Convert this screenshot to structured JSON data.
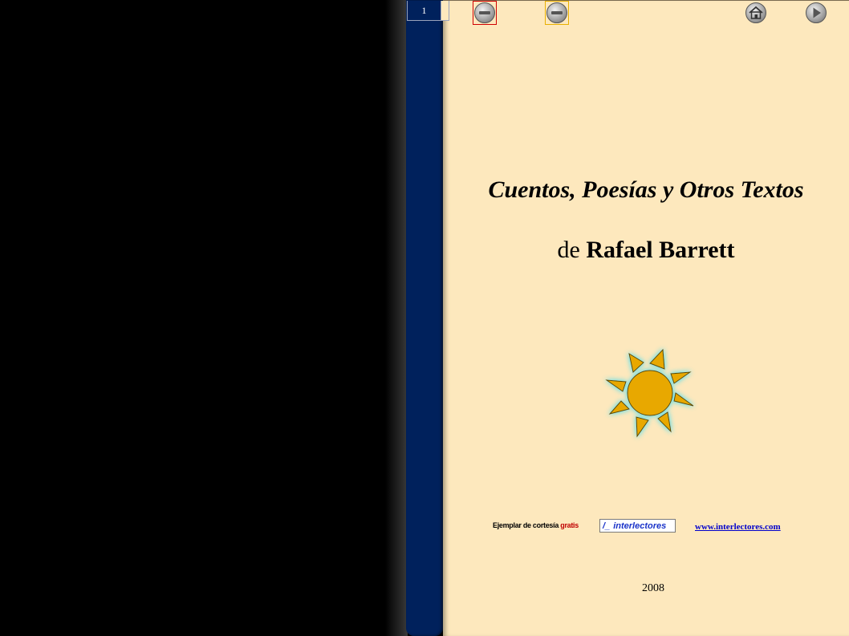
{
  "toolbar": {
    "page_number": "1",
    "buttons": [
      {
        "name": "prev-page",
        "icon": "minus-circle-icon"
      },
      {
        "name": "next-page",
        "icon": "minus-circle-icon"
      },
      {
        "name": "home",
        "icon": "home-icon"
      },
      {
        "name": "forward",
        "icon": "play-right-icon"
      }
    ]
  },
  "cover": {
    "title": "Cuentos, Poesías y Otros Textos",
    "subtitle_prefix": "de ",
    "author": "Rafael Barrett",
    "courtesy_text": "Ejemplar de cortesía ",
    "courtesy_highlight": "gratis",
    "logo_text": "interlectores",
    "url": "www.interlectores.com",
    "year": "2008"
  },
  "colors": {
    "page_background": "#fde8bd",
    "spine": "#00215c",
    "sun": "#e8a800",
    "sun_glow": "#7fe0e0",
    "link": "#0000cc",
    "gratis": "#c00000"
  }
}
